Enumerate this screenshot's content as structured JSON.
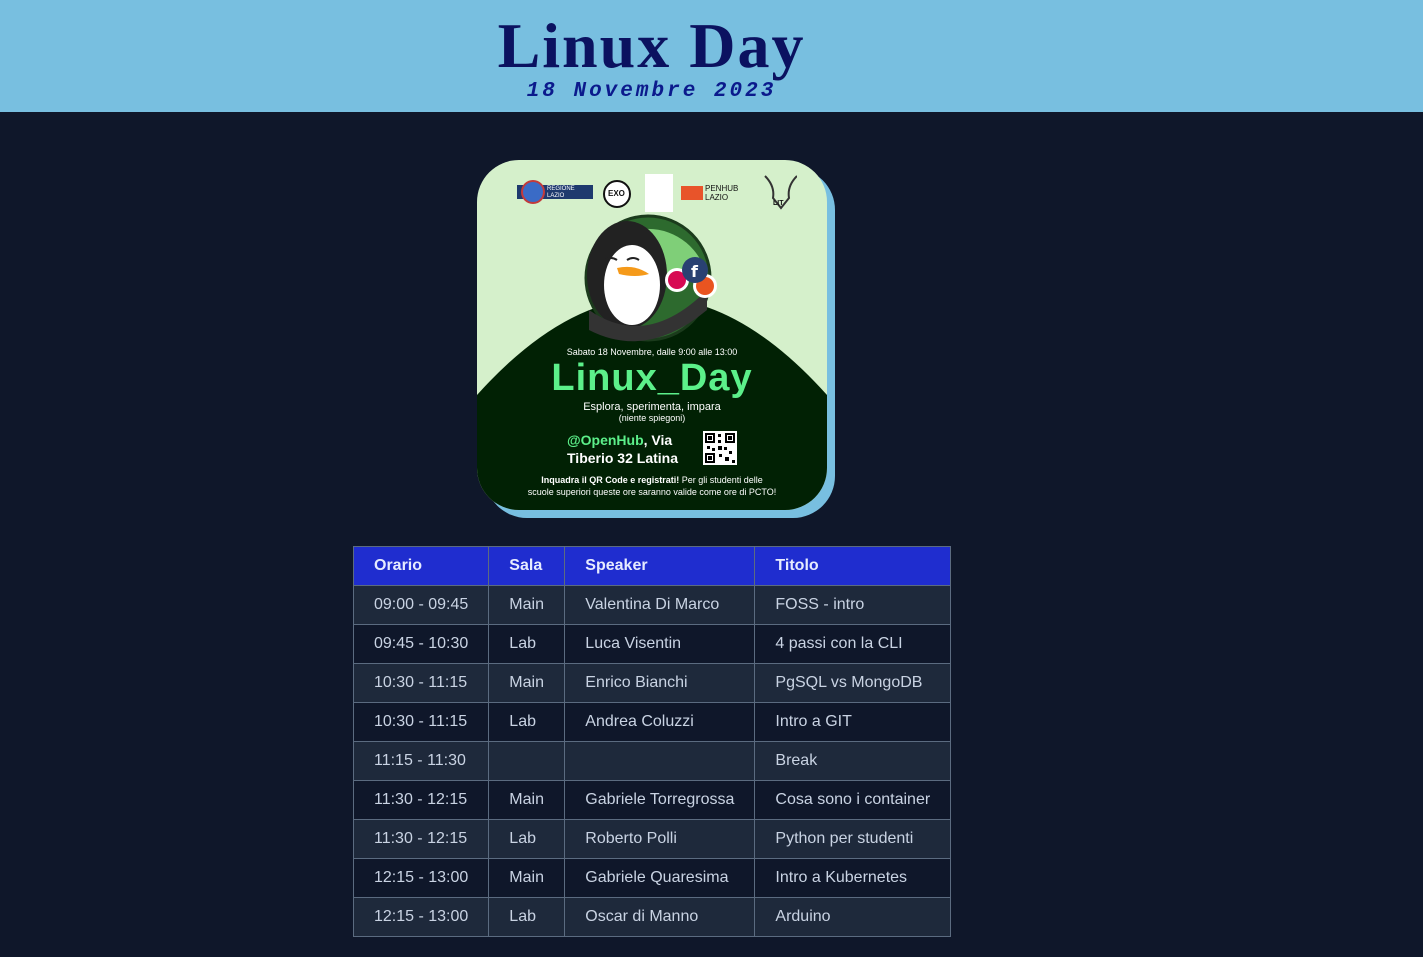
{
  "header": {
    "title": "Linux Day",
    "subtitle": "18 Novembre 2023"
  },
  "poster": {
    "logo_texts": [
      "REGIONE LAZIO",
      "EXO",
      "PENHUB LAZIO",
      "LIT"
    ],
    "date_line": "Sabato 18 Novembre, dalle 9:00 alle 13:00",
    "title": "Linux_Day",
    "tagline": "Esplora, sperimenta, impara",
    "note": "(niente spiegoni)",
    "handle": "@OpenHub",
    "address_tail": ", Via",
    "address_line2": "Tiberio 32 Latina",
    "cta_bold": "Inquadra il QR Code e registrati!",
    "cta_rest": " Per gli studenti delle",
    "cta_line2": "scuole superiori queste ore saranno valide come ore di PCTO!",
    "colors": {
      "background": "#d5f0cb",
      "dark": "#012104",
      "accent": "#5cf08a"
    }
  },
  "schedule": {
    "headers": [
      "Orario",
      "Sala",
      "Speaker",
      "Titolo"
    ],
    "rows": [
      [
        "09:00 - 09:45",
        "Main",
        "Valentina Di Marco",
        "FOSS - intro"
      ],
      [
        "09:45 - 10:30",
        "Lab",
        "Luca Visentin",
        "4 passi con la CLI"
      ],
      [
        "10:30 - 11:15",
        "Main",
        "Enrico Bianchi",
        "PgSQL vs MongoDB"
      ],
      [
        "10:30 - 11:15",
        "Lab",
        "Andrea Coluzzi",
        "Intro a GIT"
      ],
      [
        "11:15 - 11:30",
        "",
        "",
        "Break"
      ],
      [
        "11:30 - 12:15",
        "Main",
        "Gabriele Torregrossa",
        "Cosa sono i container"
      ],
      [
        "11:30 - 12:15",
        "Lab",
        "Roberto Polli",
        "Python per studenti"
      ],
      [
        "12:15 - 13:00",
        "Main",
        "Gabriele Quaresima",
        "Intro a Kubernetes"
      ],
      [
        "12:15 - 13:00",
        "Lab",
        "Oscar di Manno",
        "Arduino"
      ]
    ]
  },
  "colors": {
    "page_bg": "#0f172a",
    "header_bg": "#78bfe0",
    "title": "#0b1260",
    "table_header_bg": "#1f2dcf"
  }
}
